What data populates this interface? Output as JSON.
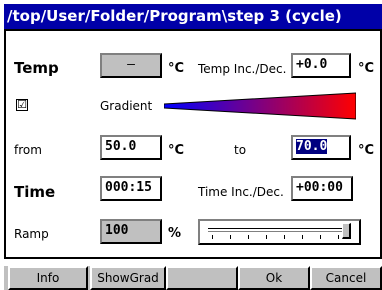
{
  "window": {
    "title": "/top/User/Folder/Program\\step 3 (cycle)"
  },
  "temp": {
    "label": "Temp",
    "value": "—",
    "unit": "°C",
    "inc_label": "Temp Inc./Dec.",
    "inc_value": "+0.0",
    "inc_unit": "°C"
  },
  "gradient": {
    "checkbox_mark": "☑",
    "checked": true,
    "label": "Gradient",
    "from_color": "#0000ff",
    "to_color": "#ff0000"
  },
  "range": {
    "from_label": "from",
    "from_value": "50.0",
    "from_unit": "°C",
    "to_label": "to",
    "to_value": "70.0",
    "to_unit": "°C"
  },
  "time": {
    "label": "Time",
    "value": "000:15",
    "inc_label": "Time Inc./Dec.",
    "inc_value": "+00:00"
  },
  "ramp": {
    "label": "Ramp",
    "value": "100",
    "unit": "%",
    "slider_level_percent": 100
  },
  "buttons": {
    "info": "Info",
    "showgrad": "ShowGrad",
    "blank": "",
    "ok": "Ok",
    "cancel": "Cancel"
  }
}
